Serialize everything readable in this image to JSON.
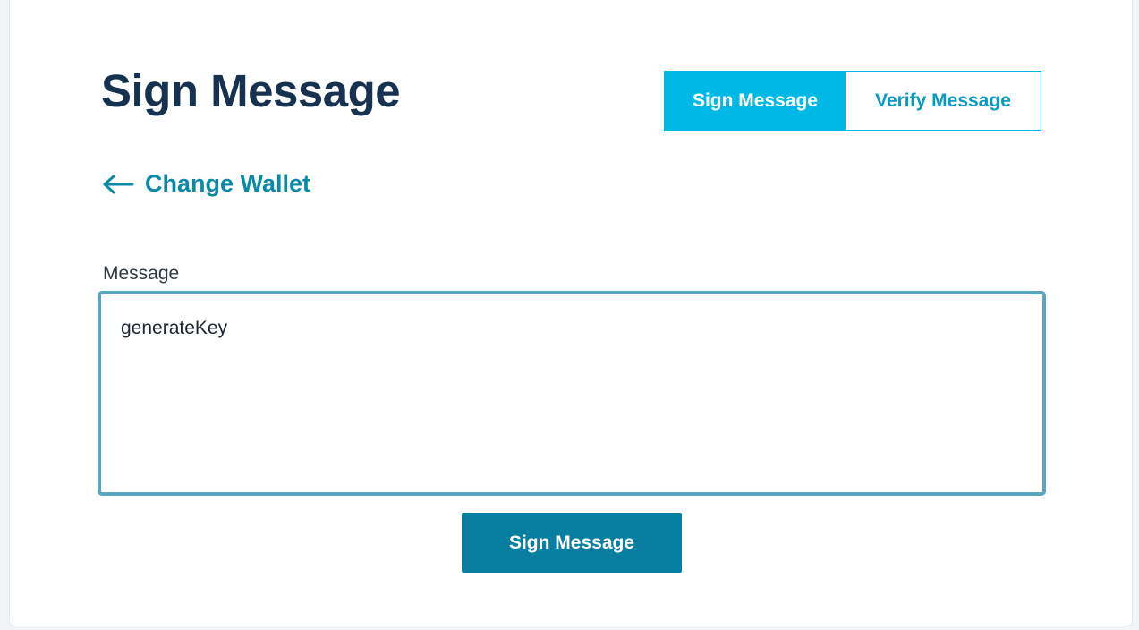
{
  "page": {
    "title": "Sign Message"
  },
  "mode_toggle": {
    "active_label": "Sign Message",
    "inactive_label": "Verify Message"
  },
  "back_link": {
    "label": "Change Wallet",
    "icon": "arrow-left-icon"
  },
  "message_field": {
    "label": "Message",
    "value": "generateKey"
  },
  "submit": {
    "label": "Sign Message"
  },
  "colors": {
    "title": "#163250",
    "accent": "#00b8e6",
    "link": "#0b8aa8",
    "field_border": "#5aa7bd",
    "button": "#087fa0"
  }
}
